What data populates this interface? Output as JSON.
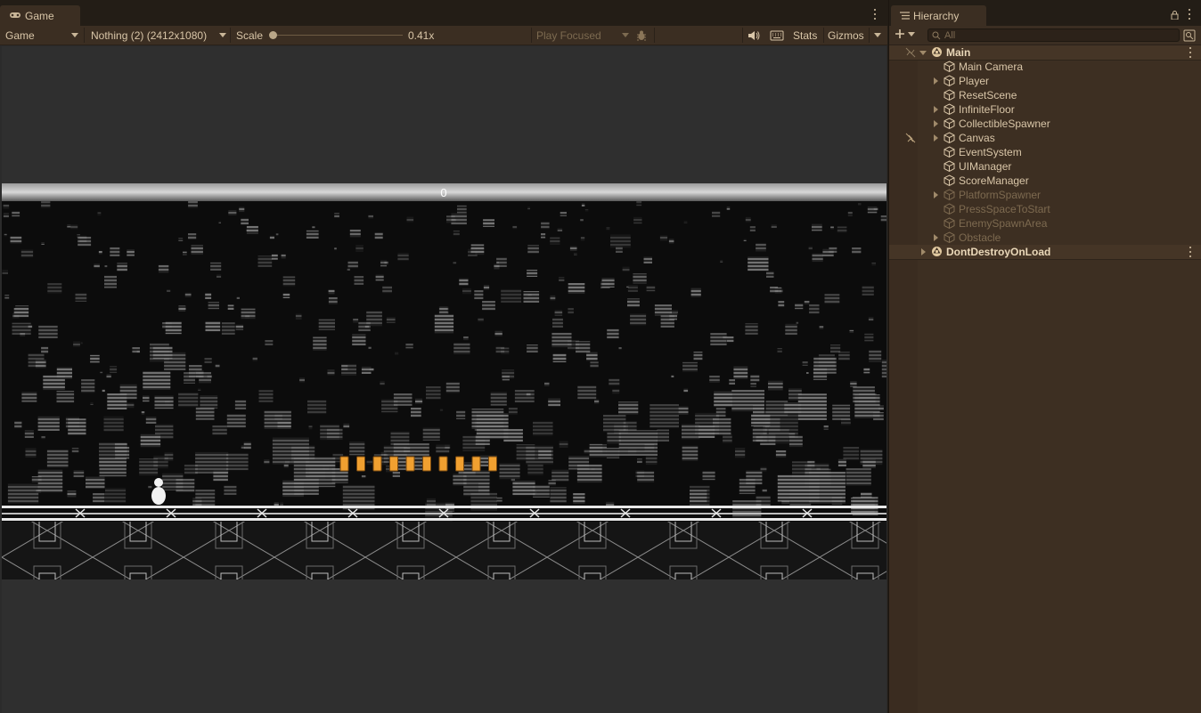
{
  "game": {
    "tab_label": "Game",
    "display_select": "Game",
    "aspect_select": "Nothing (2) (2412x1080)",
    "scale_label": "Scale",
    "scale_value": "0.41x",
    "play_mode_select": "Play Focused",
    "stats_label": "Stats",
    "gizmos_label": "Gizmos",
    "score": "0",
    "collectible_count": 10,
    "accent_color": "#f0a030"
  },
  "hierarchy": {
    "tab_label": "Hierarchy",
    "search_placeholder": "All",
    "scenes": [
      {
        "name": "Main",
        "expanded": true,
        "children": [
          {
            "name": "Main Camera",
            "has_children": false,
            "active": true
          },
          {
            "name": "Player",
            "has_children": true,
            "active": true
          },
          {
            "name": "ResetScene",
            "has_children": false,
            "active": true
          },
          {
            "name": "InfiniteFloor",
            "has_children": true,
            "active": true
          },
          {
            "name": "CollectibleSpawner",
            "has_children": true,
            "active": true
          },
          {
            "name": "Canvas",
            "has_children": true,
            "active": true
          },
          {
            "name": "EventSystem",
            "has_children": false,
            "active": true
          },
          {
            "name": "UIManager",
            "has_children": false,
            "active": true
          },
          {
            "name": "ScoreManager",
            "has_children": false,
            "active": true
          },
          {
            "name": "PlatformSpawner",
            "has_children": true,
            "active": false
          },
          {
            "name": "PressSpaceToStart",
            "has_children": false,
            "active": false
          },
          {
            "name": "EnemySpawnArea",
            "has_children": false,
            "active": false
          },
          {
            "name": "Obstacle",
            "has_children": true,
            "active": false
          }
        ]
      },
      {
        "name": "DontDestroyOnLoad",
        "expanded": false,
        "children": []
      }
    ]
  }
}
